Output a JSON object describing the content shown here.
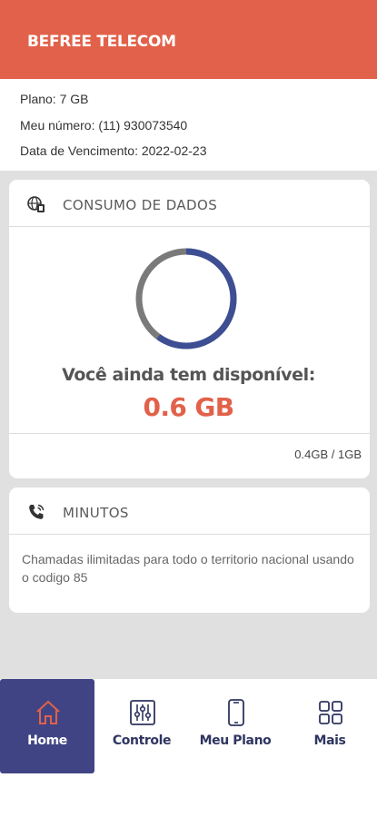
{
  "header": {
    "title": "BEFREE TELECOM"
  },
  "info": {
    "plan": "Plano: 7 GB",
    "number": "Meu número: (11) 930073540",
    "due_date": "Data de Vencimento: 2022-02-23"
  },
  "data_card": {
    "title": "CONSUMO DE DADOS",
    "icon": "globe-sim-icon",
    "available_label": "Você ainda tem disponível:",
    "available_value": "0.6 GB",
    "usage": "0.4GB / 1GB",
    "available_fraction": 0.6,
    "ring_colors": {
      "available": "#3d4e93",
      "used": "#7a7a7a"
    }
  },
  "minutes_card": {
    "title": "MINUTOS",
    "icon": "phone-call-icon",
    "text": "Chamadas ilimitadas para todo o territorio nacional usando o codigo 85"
  },
  "nav": {
    "items": [
      {
        "label": "Home",
        "icon": "home-icon",
        "active": true
      },
      {
        "label": "Controle",
        "icon": "sliders-icon",
        "active": false
      },
      {
        "label": "Meu Plano",
        "icon": "phone-icon",
        "active": false
      },
      {
        "label": "Mais",
        "icon": "grid-icon",
        "active": false
      }
    ]
  },
  "colors": {
    "brand": "#e2614a",
    "nav_active": "#404484",
    "nav_text": "#2e3560"
  }
}
